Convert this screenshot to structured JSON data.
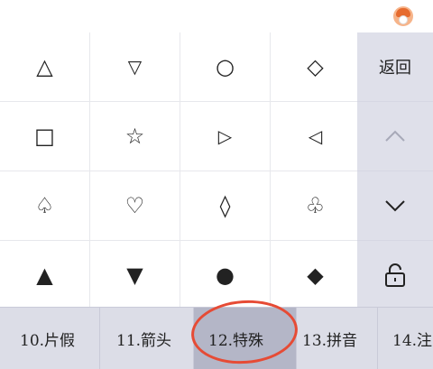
{
  "grid": {
    "rows": [
      [
        "△",
        "▽",
        "○",
        "◇"
      ],
      [
        "□",
        "☆",
        "▷",
        "◁"
      ],
      [
        "♤",
        "♡",
        "◊",
        "♧"
      ],
      [
        "▲",
        "▼",
        "●",
        "◆"
      ]
    ]
  },
  "side": {
    "back_label": "返回",
    "up_icon": "chevron-up-icon",
    "down_icon": "chevron-down-icon",
    "lock_icon": "lock-icon"
  },
  "tabs": [
    {
      "label": "10.片假",
      "active": false
    },
    {
      "label": "11.箭头",
      "active": false
    },
    {
      "label": "12.特殊",
      "active": true
    },
    {
      "label": "13.拼音",
      "active": false
    },
    {
      "label": "14.注",
      "active": false
    }
  ],
  "annotation": {
    "color": "#e64b35"
  }
}
